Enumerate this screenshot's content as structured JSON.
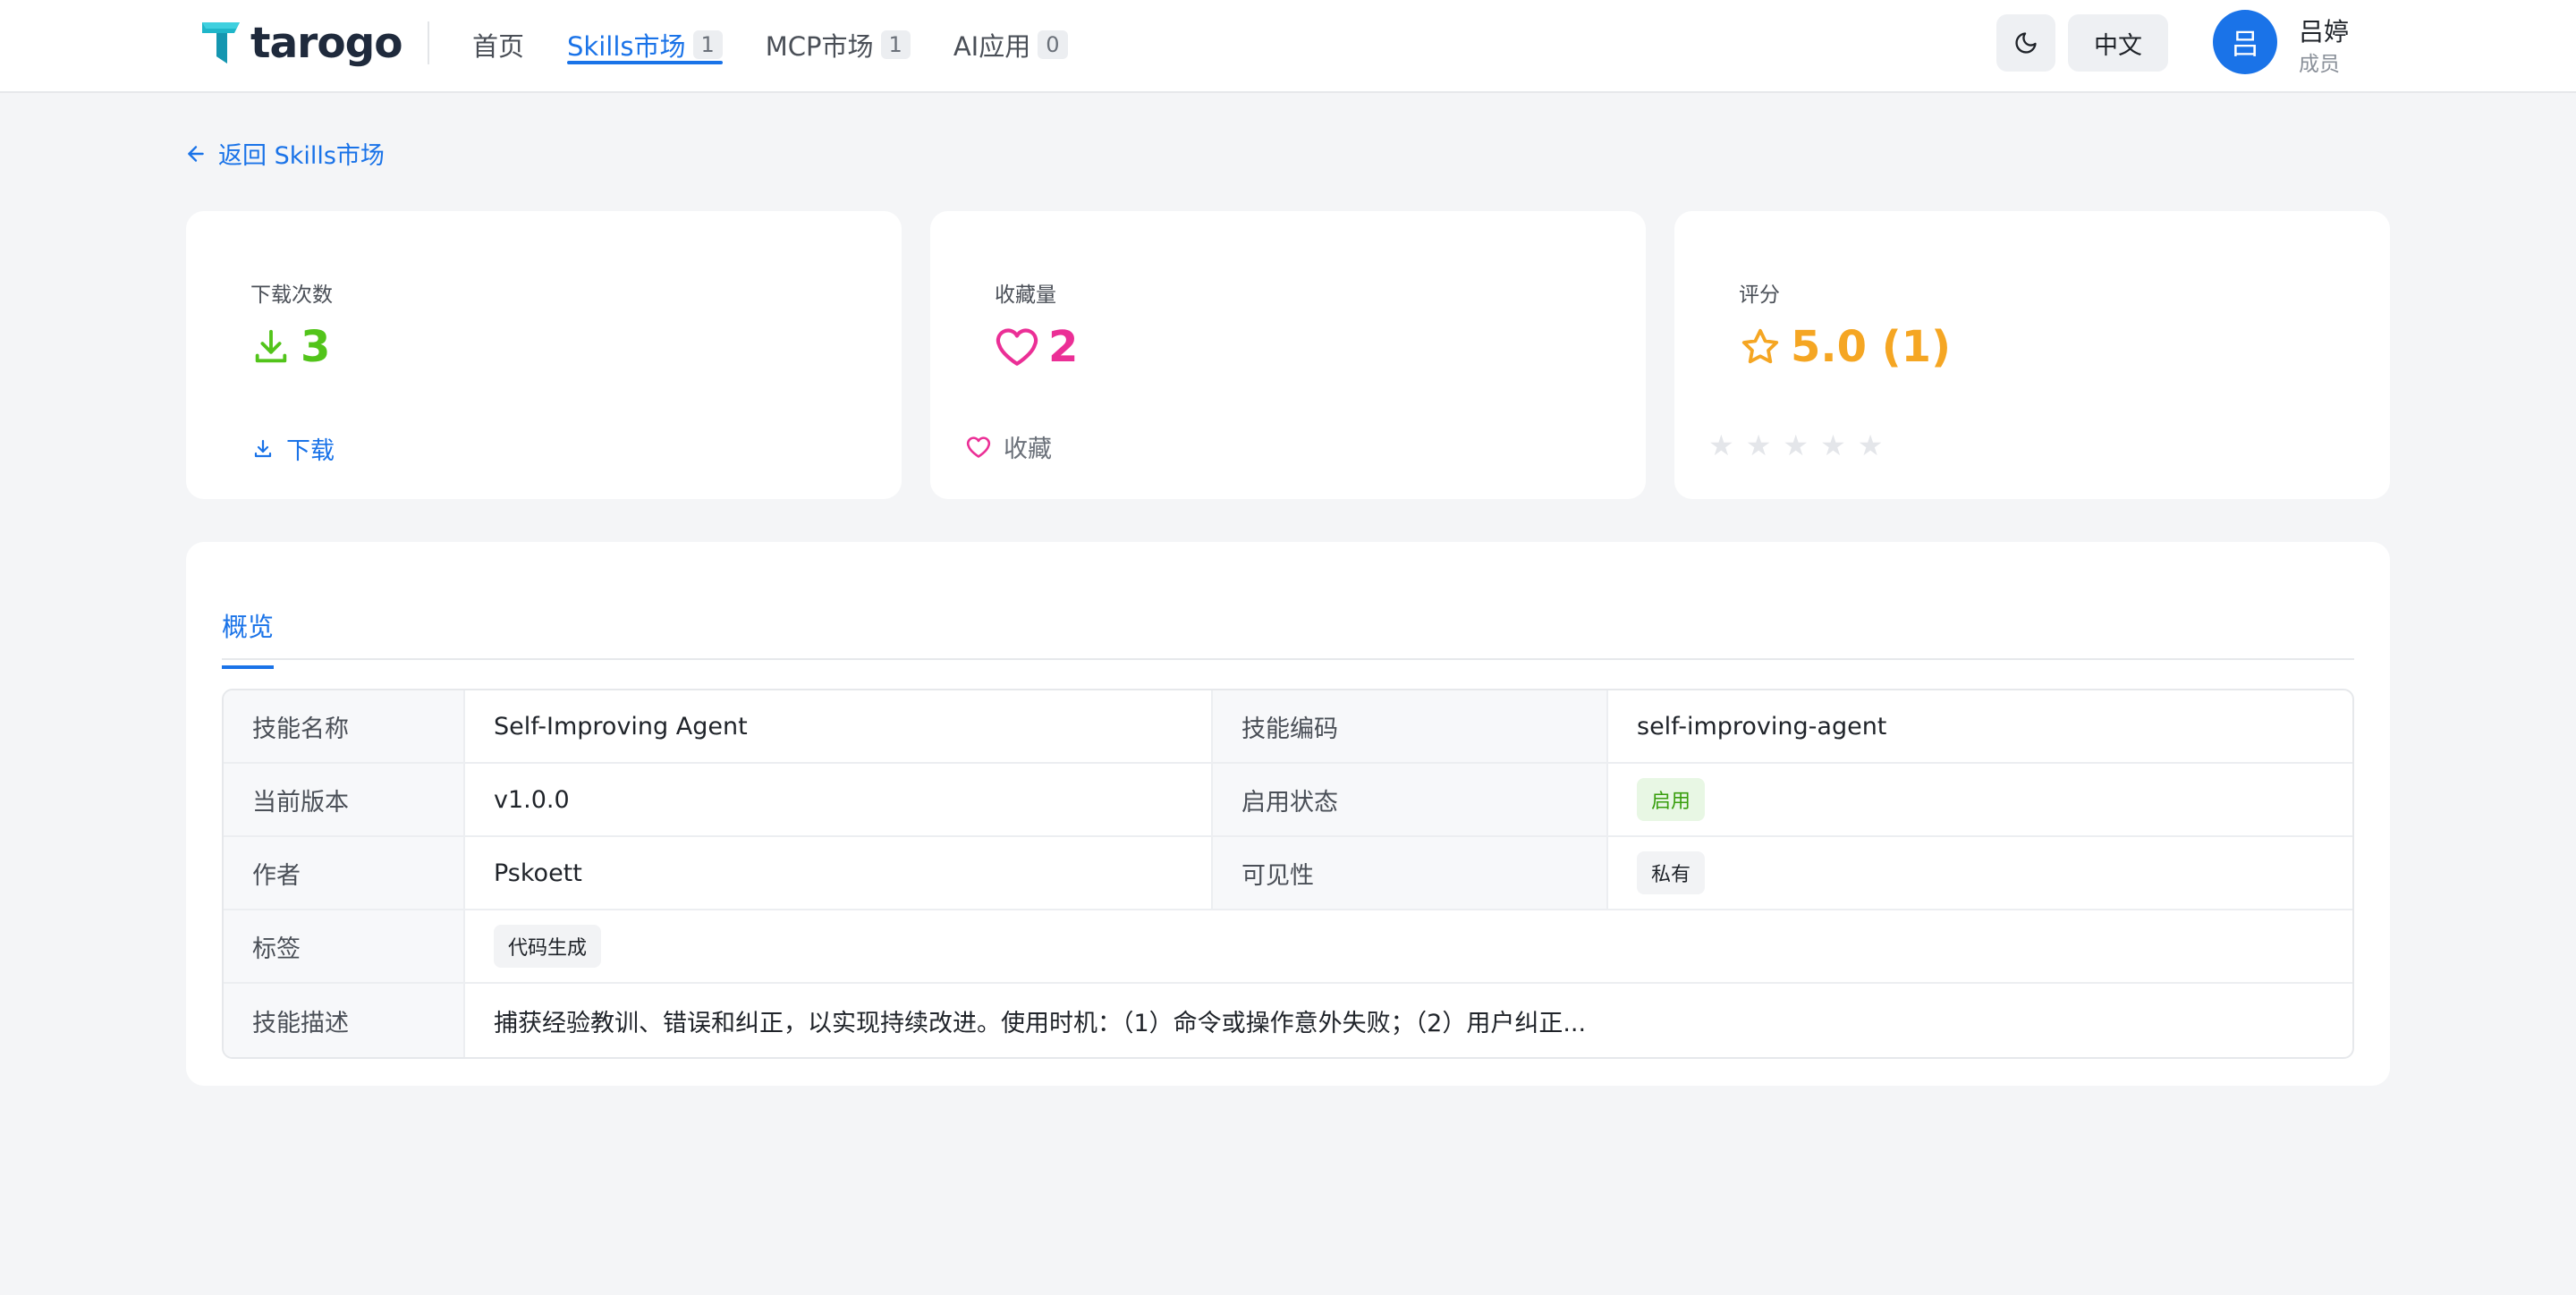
{
  "header": {
    "brand": "tarogo",
    "nav": [
      {
        "label": "首页",
        "count": null
      },
      {
        "label": "Skills市场",
        "count": "1"
      },
      {
        "label": "MCP市场",
        "count": "1"
      },
      {
        "label": "AI应用",
        "count": "0"
      }
    ],
    "active_nav": "Skills市场",
    "language": "中文",
    "user": {
      "avatar_initial": "吕",
      "name": "吕婷",
      "role": "成员"
    }
  },
  "back_link": "返回 Skills市场",
  "stats": {
    "downloads": {
      "label": "下载次数",
      "value": "3",
      "action": "下载"
    },
    "favorites": {
      "label": "收藏量",
      "value": "2",
      "action": "收藏"
    },
    "rating": {
      "label": "评分",
      "value": "5.0 (1)",
      "stars": 5,
      "user_rating": 0
    }
  },
  "tabs": [
    "概览"
  ],
  "details": {
    "name_label": "技能名称",
    "name": "Self-Improving Agent",
    "code_label": "技能编码",
    "code": "self-improving-agent",
    "version_label": "当前版本",
    "version": "v1.0.0",
    "status_label": "启用状态",
    "status": "启用",
    "author_label": "作者",
    "author": "Pskoett",
    "visibility_label": "可见性",
    "visibility": "私有",
    "tags_label": "标签",
    "tags": [
      "代码生成"
    ],
    "description_label": "技能描述",
    "description": "捕获经验教训、错误和纠正，以实现持续改进。使用时机：（1）命令或操作意外失败；（2）用户纠正..."
  },
  "colors": {
    "accent": "#1a73e8",
    "downloads": "#52c41a",
    "favorites": "#eb2f96",
    "rating": "#f5a623",
    "status_enabled": "#389e0d"
  }
}
